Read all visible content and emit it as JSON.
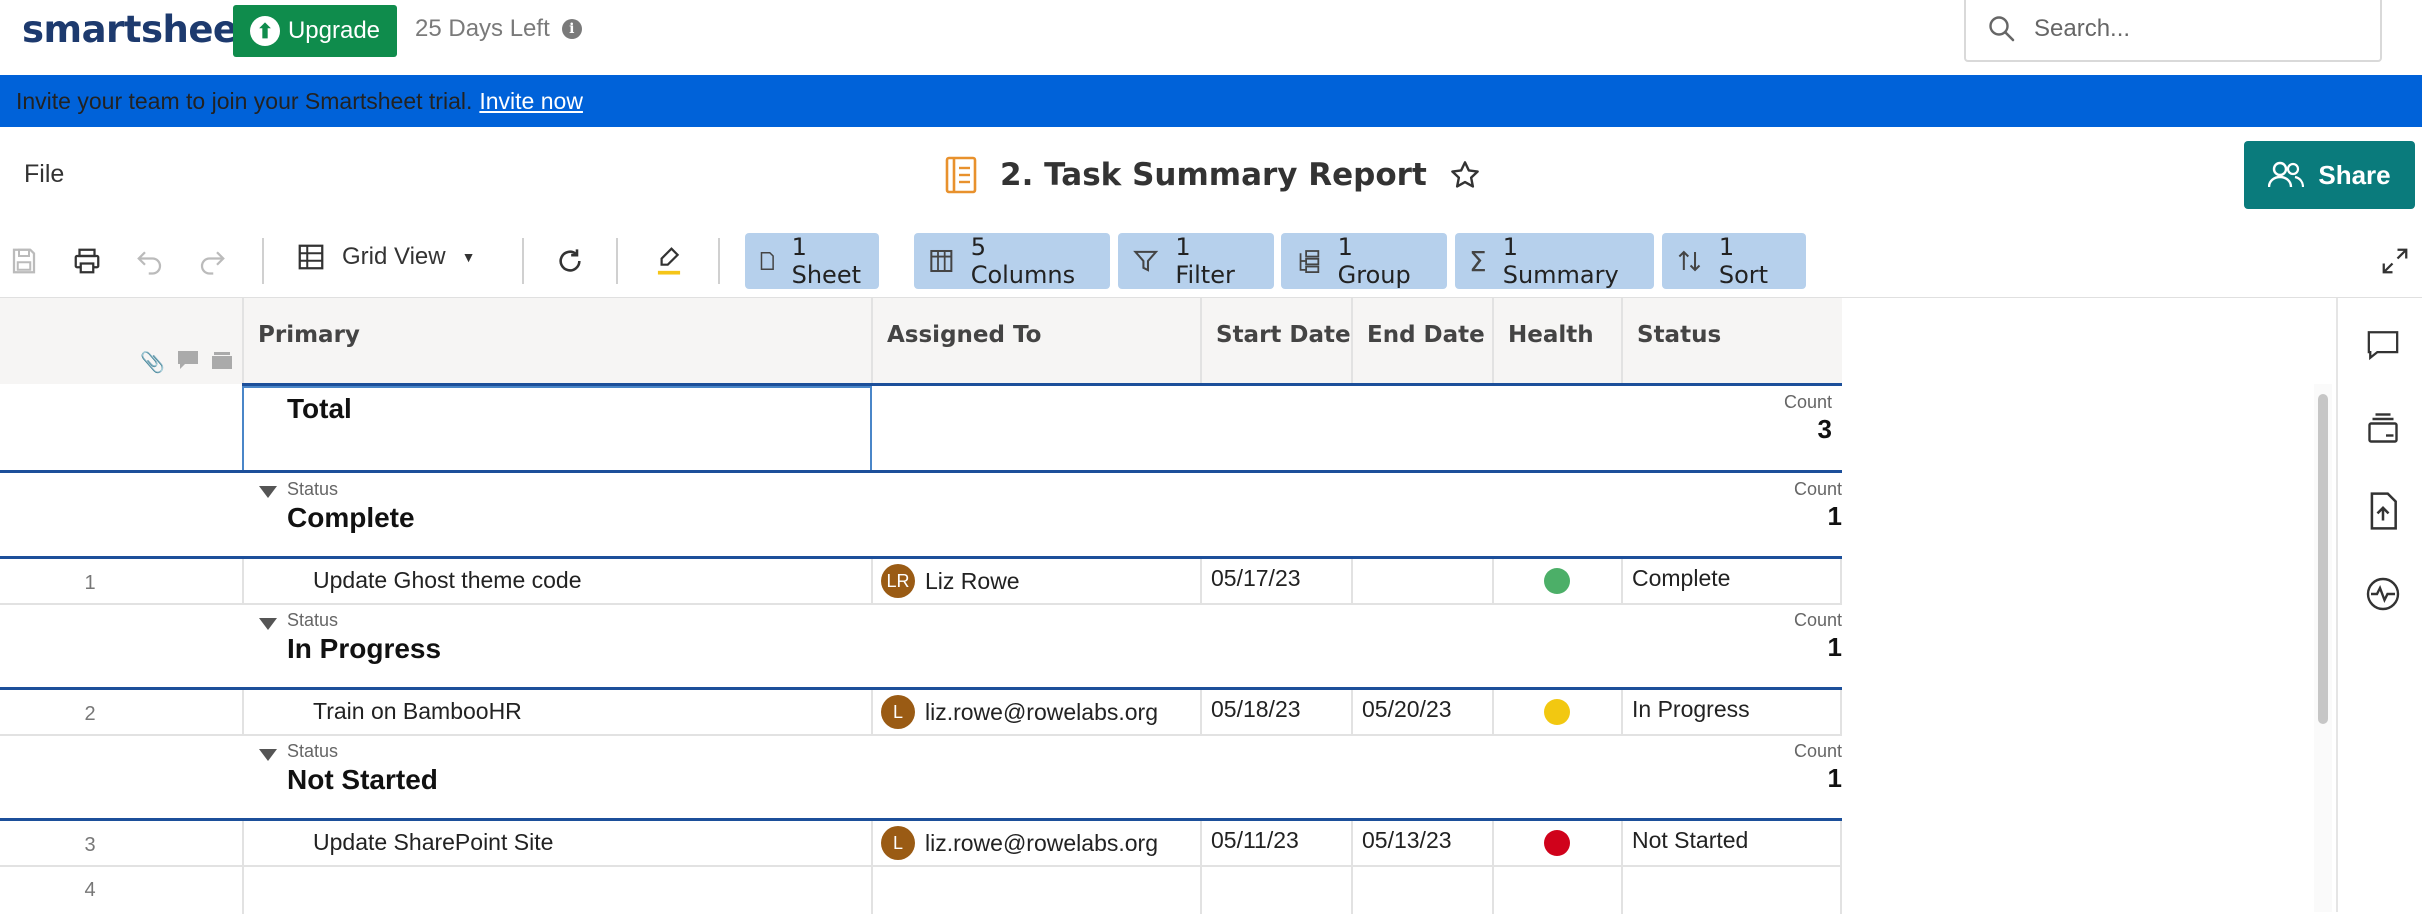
{
  "topbar": {
    "logo": "smartsheet",
    "upgrade_label": "Upgrade",
    "trial_text": "25 Days Left",
    "search_placeholder": "Search..."
  },
  "banner": {
    "text": "Invite your team to join your Smartsheet trial.",
    "link": "Invite now",
    "color": "#0062d9"
  },
  "header": {
    "file_menu": "File",
    "title": "2. Task Summary Report",
    "share_label": "Share"
  },
  "toolbar": {
    "view_label": "Grid View",
    "chips": [
      {
        "label": "1 Sheet",
        "icon": "sheet-icon"
      },
      {
        "label": "5 Columns",
        "icon": "columns-icon"
      },
      {
        "label": "1 Filter",
        "icon": "filter-icon"
      },
      {
        "label": "1 Group",
        "icon": "group-icon"
      },
      {
        "label": "1 Summary",
        "icon": "sigma-icon"
      },
      {
        "label": "1 Sort",
        "icon": "sort-icon"
      }
    ]
  },
  "columns": [
    "Primary",
    "Assigned To",
    "Start Date",
    "End Date",
    "Health",
    "Status"
  ],
  "total": {
    "label": "Total",
    "count_label": "Count",
    "count": "3"
  },
  "groups": [
    {
      "status_label": "Status",
      "name": "Complete",
      "count_label": "Count",
      "count": "1",
      "row": {
        "num": "1",
        "primary": "Update Ghost theme code",
        "avatar": "LR",
        "assigned": "Liz Rowe",
        "start": "05/17/23",
        "end": "",
        "health": "#4caf68",
        "status": "Complete"
      }
    },
    {
      "status_label": "Status",
      "name": "In Progress",
      "count_label": "Count",
      "count": "1",
      "row": {
        "num": "2",
        "primary": "Train on BambooHR",
        "avatar": "L",
        "assigned": "liz.rowe@rowelabs.org",
        "start": "05/18/23",
        "end": "05/20/23",
        "health": "#f2c811",
        "status": "In Progress"
      }
    },
    {
      "status_label": "Status",
      "name": "Not Started",
      "count_label": "Count",
      "count": "1",
      "row": {
        "num": "3",
        "primary": "Update SharePoint Site",
        "avatar": "L",
        "assigned": "liz.rowe@rowelabs.org",
        "start": "05/11/23",
        "end": "05/13/23",
        "health": "#d0021b",
        "status": "Not Started"
      }
    }
  ],
  "empty_row": {
    "num": "4"
  },
  "colors": {
    "upgrade": "#0f8c4c",
    "share": "#0a7b7c",
    "chip": "#b6d0ec",
    "group_line": "#1c4f9a"
  }
}
